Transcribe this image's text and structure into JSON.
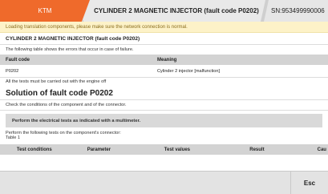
{
  "header": {
    "brand_tab": "KTM",
    "title_tab": "CYLINDER 2 MAGNETIC INJECTOR (fault code P0202)",
    "serial_tab": "SN:953499990006"
  },
  "content": {
    "loading_message": "Loading translation components, please make sure the network connection is normal.",
    "heading": "CYLINDER 2 MAGNETIC INJECTOR (fault code P0202)",
    "intro": "The following table shows the errors that occur in case of failure.",
    "fault_table": {
      "headers": [
        "Fault code",
        "Meaning"
      ],
      "rows": [
        [
          "P0202",
          "Cylinder 2 injector [malfunction]"
        ]
      ]
    },
    "engine_note": "All the tests must be carried out with the engine off",
    "solution_title": "Solution of fault code P0202",
    "check_text": "Check the conditions of the component and of the connector.",
    "electrical_note": "Perform the electrical tests as indicated with a multimeter.",
    "perform_text": "Perform the following tests on the component's connector:",
    "table_label": "Table 1",
    "test_table": {
      "headers": [
        "Test conditions",
        "Parameter",
        "Test values",
        "Result",
        "Cau"
      ]
    }
  },
  "footer": {
    "esc_label": "Esc"
  }
}
